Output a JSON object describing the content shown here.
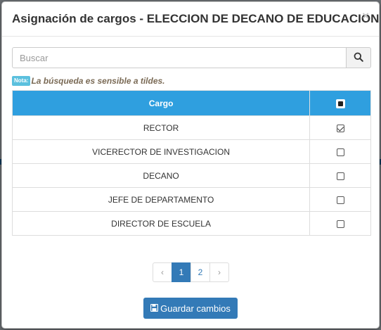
{
  "modal": {
    "title": "Asignación de cargos - ELECCION DE DECANO DE EDUCACION",
    "close_label": "×"
  },
  "search": {
    "placeholder": "Buscar",
    "value": "",
    "button_icon": "search-icon"
  },
  "note": {
    "label": "Nota:",
    "text": "La búsqueda es sensible a tildes."
  },
  "table": {
    "header_cargo": "Cargo",
    "header_select_all_checked": "partial",
    "rows": [
      {
        "cargo": "RECTOR",
        "checked": true
      },
      {
        "cargo": "VICERECTOR DE INVESTIGACION",
        "checked": false
      },
      {
        "cargo": "DECANO",
        "checked": false
      },
      {
        "cargo": "JEFE DE DEPARTAMENTO",
        "checked": false
      },
      {
        "cargo": "DIRECTOR DE ESCUELA",
        "checked": false
      }
    ]
  },
  "pagination": {
    "prev": "‹",
    "pages": [
      "1",
      "2"
    ],
    "current": "1",
    "next": "›"
  },
  "save_button": {
    "label": "Guardar cambios",
    "icon": "floppy-disk-icon"
  },
  "colors": {
    "header_blue": "#2f9fdf",
    "primary": "#337ab7",
    "note_badge": "#5bc0de"
  }
}
